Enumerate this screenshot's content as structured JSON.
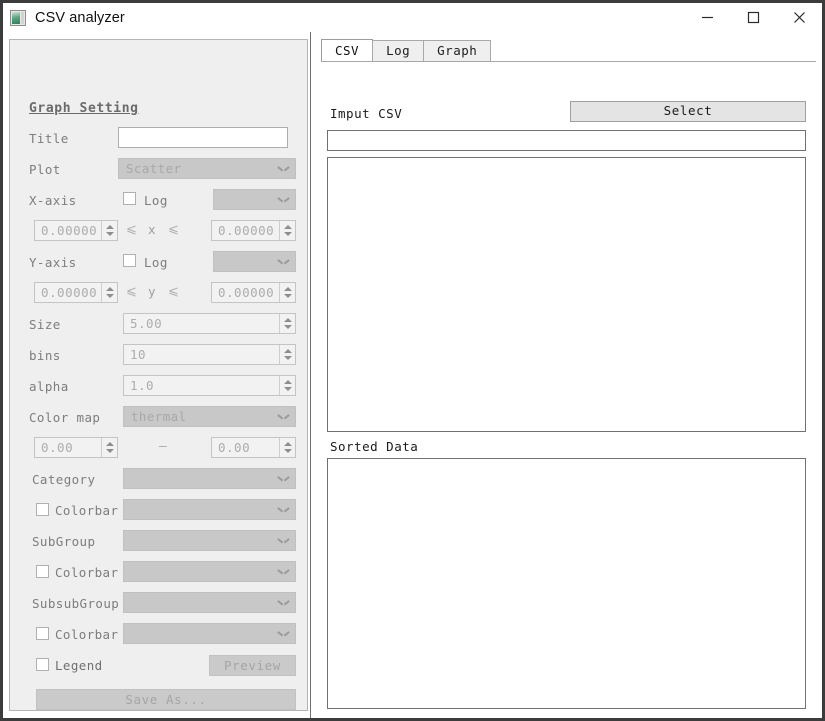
{
  "window": {
    "title": "CSV analyzer",
    "icon": "chart-image-icon",
    "controls": {
      "minimize": "minimize-icon",
      "maximize": "maximize-icon",
      "close": "close-icon"
    }
  },
  "settings_panel": {
    "heading": "Graph Setting",
    "title_row": {
      "label": "Title",
      "value": "",
      "placeholder": ""
    },
    "plot_row": {
      "label": "Plot",
      "value": "Scatter",
      "options": [
        "Scatter"
      ]
    },
    "x_axis": {
      "label": "X-axis",
      "log_label": "Log",
      "log_checked": false,
      "column": "",
      "min": "0.00000",
      "max": "0.00000",
      "cmp_left": "⩽",
      "cmp_right": "⩽",
      "var": "x"
    },
    "y_axis": {
      "label": "Y-axis",
      "log_label": "Log",
      "log_checked": false,
      "column": "",
      "min": "0.00000",
      "max": "0.00000",
      "cmp_left": "⩽",
      "cmp_right": "⩽",
      "var": "y"
    },
    "size": {
      "label": "Size",
      "value": "5.00"
    },
    "bins": {
      "label": "bins",
      "value": "10"
    },
    "alpha": {
      "label": "alpha",
      "value": "1.0"
    },
    "color_map": {
      "label": "Color map",
      "value": "thermal",
      "options": [
        "thermal"
      ]
    },
    "color_range": {
      "min": "0.00",
      "max": "0.00",
      "separator": "—"
    },
    "category": {
      "label": "Category",
      "value": ""
    },
    "category_colorbar": {
      "label": "Colorbar",
      "checked": false,
      "value": ""
    },
    "subgroup": {
      "label": "SubGroup",
      "value": ""
    },
    "subgroup_colorbar": {
      "label": "Colorbar",
      "checked": false,
      "value": ""
    },
    "subsubgroup": {
      "label": "SubsubGroup",
      "value": ""
    },
    "subsubgroup_colorbar": {
      "label": "Colorbar",
      "checked": false,
      "value": ""
    },
    "legend": {
      "label": "Legend",
      "checked": false
    },
    "preview_button": "Preview",
    "save_as_button": "Save As..."
  },
  "right_panel": {
    "tabs": [
      {
        "label": "CSV",
        "active": true
      },
      {
        "label": "Log",
        "active": false
      },
      {
        "label": "Graph",
        "active": false
      }
    ],
    "input_csv_label": "Imput CSV",
    "select_button": "Select",
    "path_field": {
      "value": "",
      "placeholder": ""
    },
    "csv_preview": {
      "value": ""
    },
    "sorted_data_label": "Sorted Data",
    "sorted_data": {
      "value": ""
    }
  },
  "colors": {
    "window_border": "#3c3c3c",
    "panel_bg": "#efefef",
    "disabled_control": "#c8c8c8",
    "field_border": "#707070",
    "accent_icon": "#2f7d5c"
  }
}
